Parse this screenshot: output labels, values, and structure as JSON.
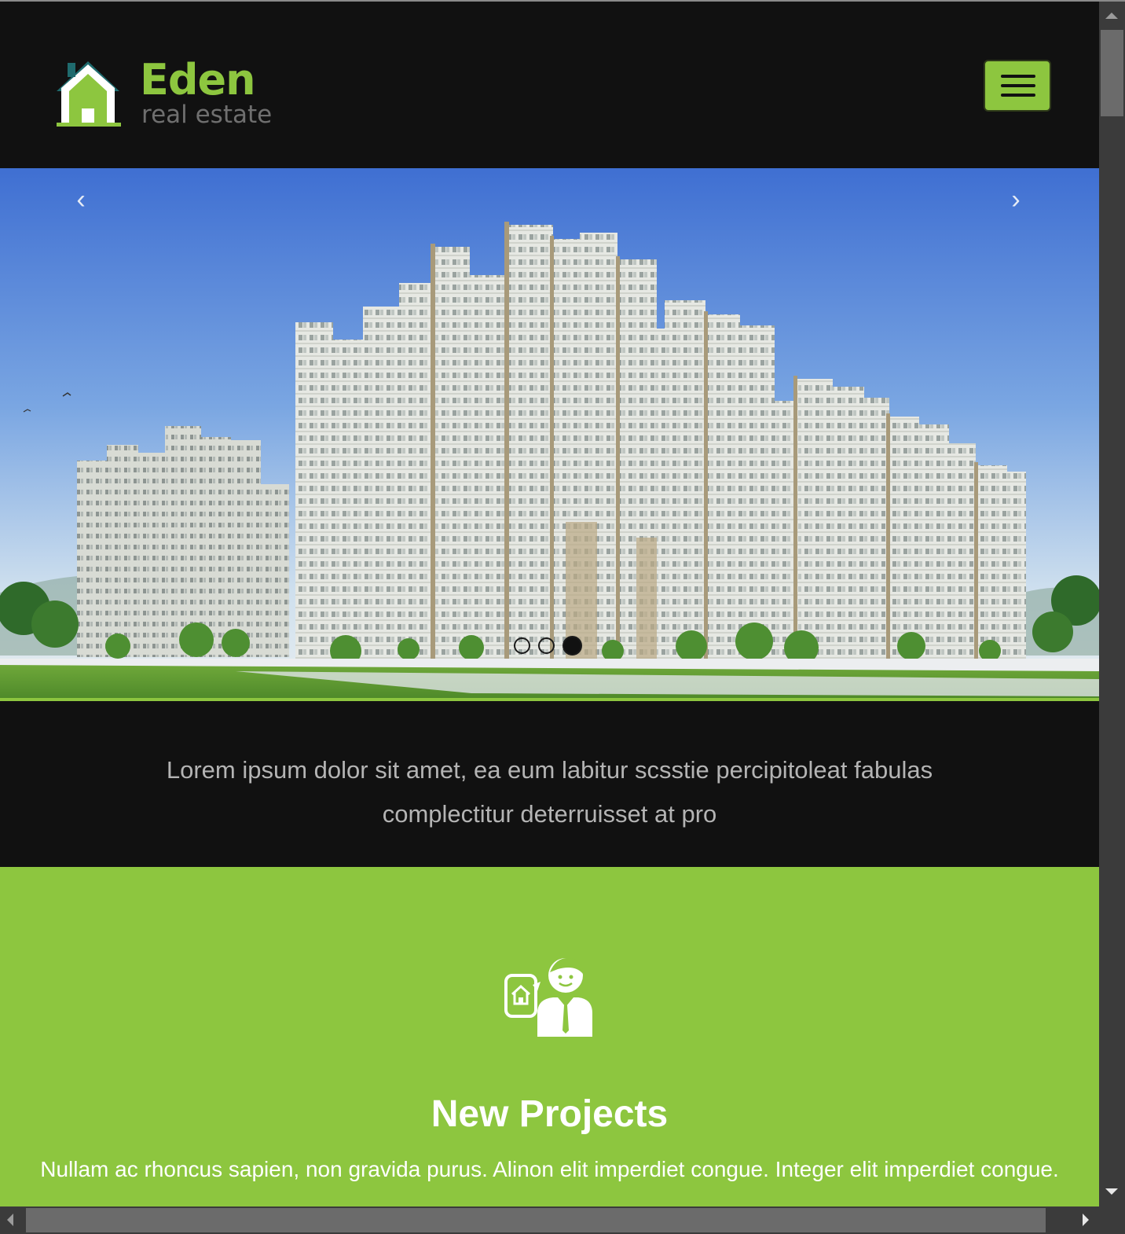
{
  "header": {
    "logo_name": "Eden",
    "logo_sub": "real estate",
    "menu_icon": "hamburger-icon"
  },
  "hero": {
    "prev_label": "‹",
    "next_label": "›",
    "slide_count": 3,
    "active_slide": 3
  },
  "tagline": {
    "text": "Lorem ipsum dolor sit amet, ea eum labitur scsstie percipitoleat fabulas complectitur deterruisset at pro"
  },
  "feature": {
    "icon": "agent-with-house-icon",
    "title": "New Projects",
    "text": "Nullam ac rhoncus sapien, non gravida purus. Alinon elit imperdiet congue. Integer elit imperdiet congue."
  },
  "colors": {
    "brand_green": "#8dc63f",
    "background_dark": "#111111",
    "tagline_text": "#b4b4b4"
  }
}
